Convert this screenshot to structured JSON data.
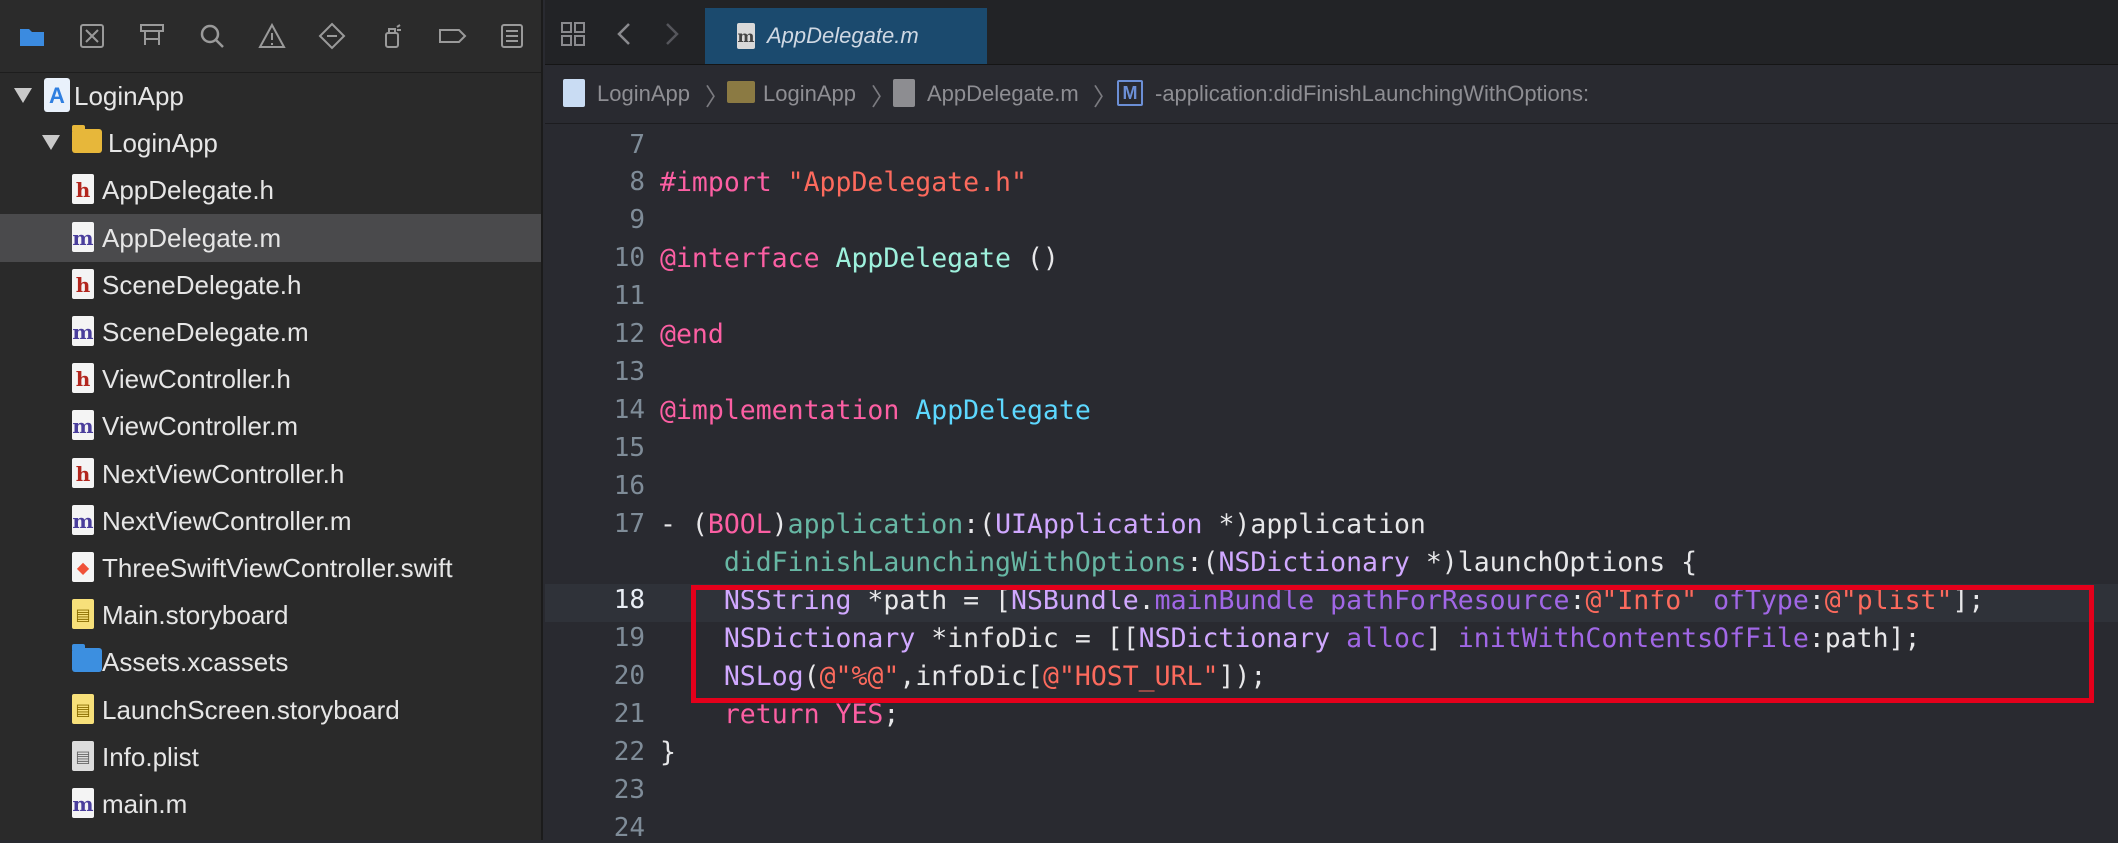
{
  "navigator": {
    "toolbar_icons": [
      "folder-icon",
      "source-control-icon",
      "hierarchy-icon",
      "search-icon",
      "warning-icon",
      "test-diamond-icon",
      "debug-spray-icon",
      "breakpoint-icon",
      "report-icon"
    ],
    "tree": [
      {
        "label": "LoginApp",
        "kind": "project",
        "level": 0,
        "expanded": true
      },
      {
        "label": "LoginApp",
        "kind": "folder",
        "level": 1,
        "expanded": true
      },
      {
        "label": "AppDelegate.h",
        "kind": "h",
        "level": 2
      },
      {
        "label": "AppDelegate.m",
        "kind": "m",
        "level": 2,
        "selected": true
      },
      {
        "label": "SceneDelegate.h",
        "kind": "h",
        "level": 2
      },
      {
        "label": "SceneDelegate.m",
        "kind": "m",
        "level": 2
      },
      {
        "label": "ViewController.h",
        "kind": "h",
        "level": 2
      },
      {
        "label": "ViewController.m",
        "kind": "m",
        "level": 2
      },
      {
        "label": "NextViewController.h",
        "kind": "h",
        "level": 2
      },
      {
        "label": "NextViewController.m",
        "kind": "m",
        "level": 2
      },
      {
        "label": "ThreeSwiftViewController.swift",
        "kind": "swift",
        "level": 2
      },
      {
        "label": "Main.storyboard",
        "kind": "storyboard",
        "level": 2
      },
      {
        "label": "Assets.xcassets",
        "kind": "assets",
        "level": 2
      },
      {
        "label": "LaunchScreen.storyboard",
        "kind": "storyboard",
        "level": 2
      },
      {
        "label": "Info.plist",
        "kind": "plist",
        "level": 2
      },
      {
        "label": "main.m",
        "kind": "m",
        "level": 2
      }
    ]
  },
  "editor": {
    "tab": {
      "label": "AppDelegate.m",
      "icon": "m"
    },
    "breadcrumb": [
      "LoginApp",
      "LoginApp",
      "AppDelegate.m",
      "-application:didFinishLaunchingWithOptions:"
    ],
    "breadcrumb_method_badge": "M",
    "current_line": "18",
    "line_numbers": [
      "7",
      "8",
      "9",
      "10",
      "11",
      "12",
      "13",
      "14",
      "15",
      "16",
      "17",
      "",
      "18",
      "19",
      "20",
      "21",
      "22",
      "23",
      "24"
    ],
    "code": [
      {
        "line": "7",
        "tokens": []
      },
      {
        "line": "8",
        "tokens": [
          {
            "t": "#import ",
            "c": "kw"
          },
          {
            "t": "\"AppDelegate.h\"",
            "c": "str"
          }
        ]
      },
      {
        "line": "9",
        "tokens": []
      },
      {
        "line": "10",
        "tokens": [
          {
            "t": "@interface ",
            "c": "kw"
          },
          {
            "t": "AppDelegate",
            "c": "cls"
          },
          {
            "t": " ()",
            "c": "plain"
          }
        ]
      },
      {
        "line": "11",
        "tokens": []
      },
      {
        "line": "12",
        "tokens": [
          {
            "t": "@end",
            "c": "kw"
          }
        ]
      },
      {
        "line": "13",
        "tokens": []
      },
      {
        "line": "14",
        "tokens": [
          {
            "t": "@implementation ",
            "c": "kw"
          },
          {
            "t": "AppDelegate",
            "c": "cls2"
          }
        ]
      },
      {
        "line": "15",
        "tokens": []
      },
      {
        "line": "16",
        "tokens": []
      },
      {
        "line": "17",
        "tokens": [
          {
            "t": "- (",
            "c": "plain"
          },
          {
            "t": "BOOL",
            "c": "kw"
          },
          {
            "t": ")",
            "c": "plain"
          },
          {
            "t": "application",
            "c": "mth"
          },
          {
            "t": ":(",
            "c": "plain"
          },
          {
            "t": "UIApplication",
            "c": "type"
          },
          {
            "t": " *)application",
            "c": "plain"
          }
        ]
      },
      {
        "line": "",
        "tokens": [
          {
            "t": "    ",
            "c": "plain"
          },
          {
            "t": "didFinishLaunchingWithOptions",
            "c": "mth"
          },
          {
            "t": ":(",
            "c": "plain"
          },
          {
            "t": "NSDictionary",
            "c": "type"
          },
          {
            "t": " *)launchOptions {",
            "c": "plain"
          }
        ]
      },
      {
        "line": "18",
        "tokens": [
          {
            "t": "    ",
            "c": "plain"
          },
          {
            "t": "NSString",
            "c": "type"
          },
          {
            "t": " *path = [",
            "c": "plain"
          },
          {
            "t": "NSBundle",
            "c": "type"
          },
          {
            "t": ".",
            "c": "plain"
          },
          {
            "t": "mainBundle",
            "c": "mth2"
          },
          {
            "t": " ",
            "c": "plain"
          },
          {
            "t": "pathForResource",
            "c": "mth2"
          },
          {
            "t": ":",
            "c": "plain"
          },
          {
            "t": "@\"Info\"",
            "c": "str"
          },
          {
            "t": " ",
            "c": "plain"
          },
          {
            "t": "ofType",
            "c": "mth2"
          },
          {
            "t": ":",
            "c": "plain"
          },
          {
            "t": "@\"plist\"",
            "c": "str"
          },
          {
            "t": "];",
            "c": "plain"
          }
        ]
      },
      {
        "line": "19",
        "tokens": [
          {
            "t": "    ",
            "c": "plain"
          },
          {
            "t": "NSDictionary",
            "c": "type"
          },
          {
            "t": " *infoDic = [[",
            "c": "plain"
          },
          {
            "t": "NSDictionary",
            "c": "type"
          },
          {
            "t": " ",
            "c": "plain"
          },
          {
            "t": "alloc",
            "c": "mth2"
          },
          {
            "t": "] ",
            "c": "plain"
          },
          {
            "t": "initWithContentsOfFile",
            "c": "mth2"
          },
          {
            "t": ":path];",
            "c": "plain"
          }
        ]
      },
      {
        "line": "20",
        "tokens": [
          {
            "t": "    ",
            "c": "plain"
          },
          {
            "t": "NSLog",
            "c": "type"
          },
          {
            "t": "(",
            "c": "plain"
          },
          {
            "t": "@\"%@\"",
            "c": "str"
          },
          {
            "t": ",infoDic[",
            "c": "plain"
          },
          {
            "t": "@\"HOST_URL\"",
            "c": "str"
          },
          {
            "t": "]);",
            "c": "plain"
          }
        ]
      },
      {
        "line": "21",
        "tokens": [
          {
            "t": "    ",
            "c": "plain"
          },
          {
            "t": "return ",
            "c": "kw"
          },
          {
            "t": "YES",
            "c": "kw"
          },
          {
            "t": ";",
            "c": "plain"
          }
        ]
      },
      {
        "line": "22",
        "tokens": [
          {
            "t": "}",
            "c": "plain"
          }
        ]
      },
      {
        "line": "23",
        "tokens": []
      },
      {
        "line": "24",
        "tokens": []
      }
    ]
  },
  "colors": {
    "keyword": "#fc5fa3",
    "string": "#fc6a5d",
    "type": "#d0a8ff",
    "class": "#9ef1dd",
    "method": "#67b7a4",
    "highlight": "#e4001b"
  }
}
